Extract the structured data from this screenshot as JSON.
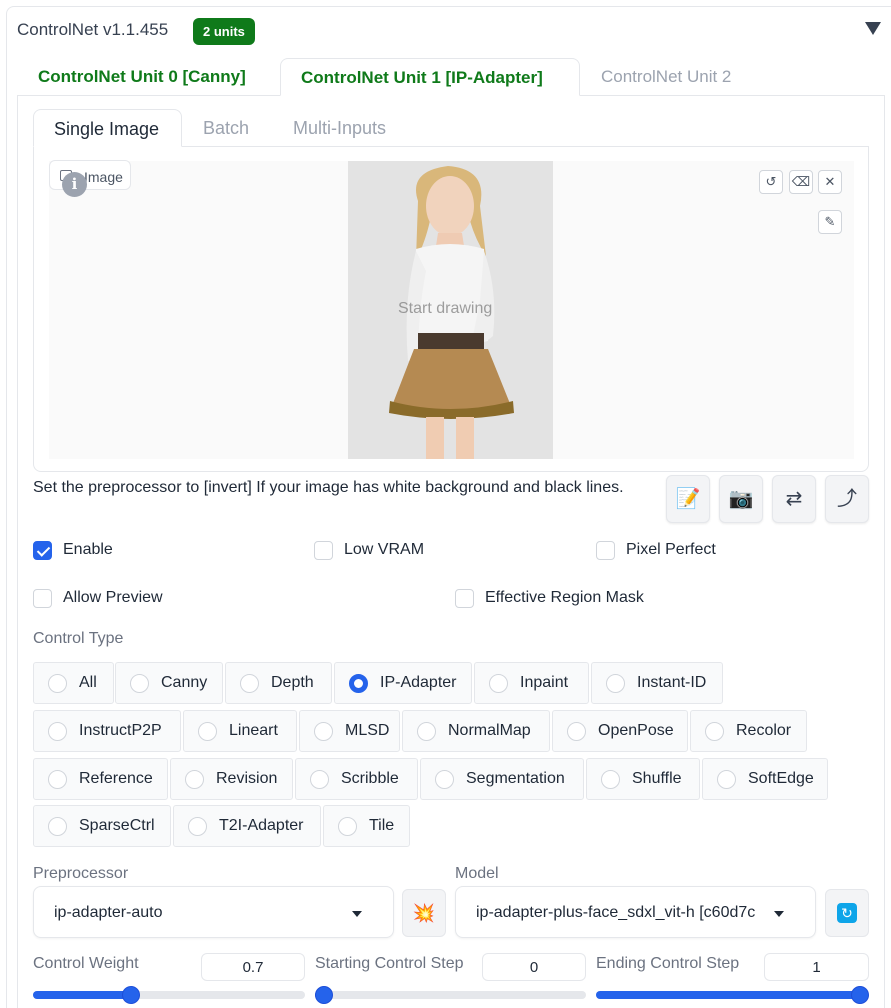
{
  "header": {
    "title": "ControlNet v1.1.455",
    "badge": "2 units"
  },
  "unit_tabs": [
    {
      "label": "ControlNet Unit 0 [Canny]"
    },
    {
      "label": "ControlNet Unit 1 [IP-Adapter]",
      "selected": true
    },
    {
      "label": "ControlNet Unit 2"
    }
  ],
  "input_tabs": [
    {
      "label": "Single Image",
      "selected": true
    },
    {
      "label": "Batch"
    },
    {
      "label": "Multi-Inputs"
    }
  ],
  "image_panel": {
    "label": "Image",
    "info_glyph": "i",
    "overlay_text": "Start drawing"
  },
  "hint": "Set the preprocessor to [invert] If your image has white background and black lines.",
  "checkboxes": {
    "enable": {
      "label": "Enable",
      "checked": true
    },
    "low_vram": {
      "label": "Low VRAM",
      "checked": false
    },
    "pixel_perfect": {
      "label": "Pixel Perfect",
      "checked": false
    },
    "allow_preview": {
      "label": "Allow Preview",
      "checked": false
    },
    "effective_region_mask": {
      "label": "Effective Region Mask",
      "checked": false
    }
  },
  "control_type": {
    "label": "Control Type",
    "options": [
      "All",
      "Canny",
      "Depth",
      "IP-Adapter",
      "Inpaint",
      "Instant-ID",
      "InstructP2P",
      "Lineart",
      "MLSD",
      "NormalMap",
      "OpenPose",
      "Recolor",
      "Reference",
      "Revision",
      "Scribble",
      "Segmentation",
      "Shuffle",
      "SoftEdge",
      "SparseCtrl",
      "T2I-Adapter",
      "Tile"
    ],
    "selected": "IP-Adapter"
  },
  "preprocessor": {
    "label": "Preprocessor",
    "value": "ip-adapter-auto"
  },
  "model": {
    "label": "Model",
    "value": "ip-adapter-plus-face_sdxl_vit-h [c60d7c"
  },
  "control_weight": {
    "label": "Control Weight",
    "value": "0.7",
    "level": 0.35
  },
  "starting_step": {
    "label": "Starting Control Step",
    "value": "0",
    "level": 0.0
  },
  "ending_step": {
    "label": "Ending Control Step",
    "value": "1",
    "level": 1.0
  },
  "icons": [
    "image-icon",
    "info-icon",
    "reset-icon",
    "eraser-icon",
    "close-icon",
    "brush-icon",
    "edit-icon",
    "camera-icon",
    "swap-icon",
    "send-icon",
    "explode-icon",
    "refresh-icon"
  ],
  "colors": {
    "accent": "#2563eb",
    "badge": "#0f7a1a",
    "tab_active": "#0f7a1a"
  }
}
